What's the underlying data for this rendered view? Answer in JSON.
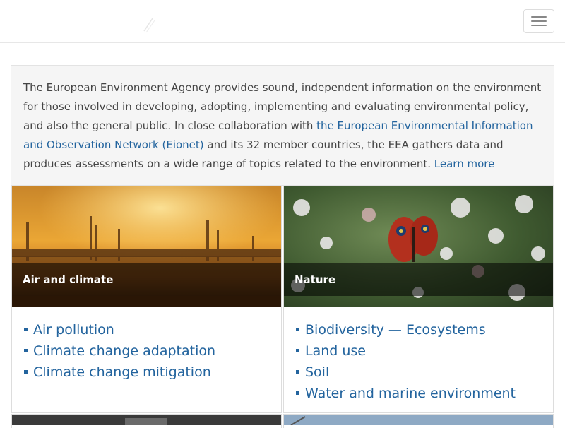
{
  "header": {
    "logo_icon": "eea-logo-icon",
    "menu_icon": "hamburger-menu-icon"
  },
  "intro": {
    "text_1": "The European Environment Agency provides sound, independent information on the environment for those involved in developing, adopting, implementing and evaluating environmental policy, and also the general public. In close collaboration with ",
    "eionet_link": "the European Environmental Information and Observation Network (Eionet)",
    "text_2": " and its 32 member countries, the EEA gathers data and produces assessments on a wide range of topics related to the environment. ",
    "learn_more": "Learn more"
  },
  "cards": [
    {
      "title": "Air and climate",
      "topics": [
        "Air pollution",
        "Climate change adaptation",
        "Climate change mitigation"
      ]
    },
    {
      "title": "Nature",
      "topics": [
        "Biodiversity — Ecosystems",
        "Land use",
        "Soil",
        "Water and marine environment"
      ]
    }
  ],
  "colors": {
    "link": "#23649e",
    "intro_bg": "#f5f5f5",
    "title_overlay": "rgba(0,0,0,0.55)"
  }
}
